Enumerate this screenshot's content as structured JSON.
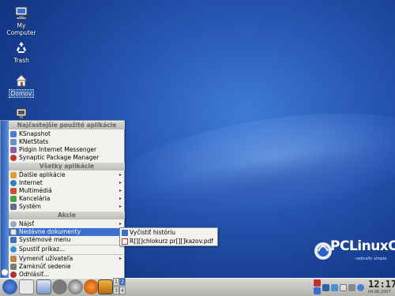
{
  "desktop": {
    "icons": [
      {
        "label": "My\nComputer",
        "name": "my-computer"
      },
      {
        "label": "Trash",
        "name": "trash"
      },
      {
        "label": "Domov",
        "name": "domov"
      }
    ],
    "logo": {
      "text": "PCLinuxOS",
      "tagline": "radically simple."
    }
  },
  "menu": {
    "sections": {
      "recent": "Najčastejšie použité aplikácie",
      "all": "Všetky aplikácie",
      "actions": "Akcie"
    },
    "recent_items": [
      "KSnapshot",
      "KNetStats",
      "Pidgin Internet Messenger",
      "Synaptic Package Manager"
    ],
    "app_items": [
      "Ďalšie aplikácie",
      "Internet",
      "Multimédiá",
      "Kancelária",
      "Systém"
    ],
    "action_items": [
      "Nájsť",
      "Nedávne dokumenty",
      "Systémové menu",
      "Spustiť príkaz...",
      "Vymeniť užívateľa",
      "Zamknúť sedenie",
      "Odhlásiť..."
    ]
  },
  "submenu": {
    "items": [
      "Vyčistiť históriu",
      "R[][]chlokurz pr[][]kazov.pdf"
    ]
  },
  "taskbar": {
    "pager": [
      "1",
      "2",
      "3",
      "4"
    ],
    "clock": "12:17",
    "date": "04.06.2007"
  },
  "colors": {
    "accent": "#3a6fcf",
    "menu_bg": "#f2f2ee"
  }
}
